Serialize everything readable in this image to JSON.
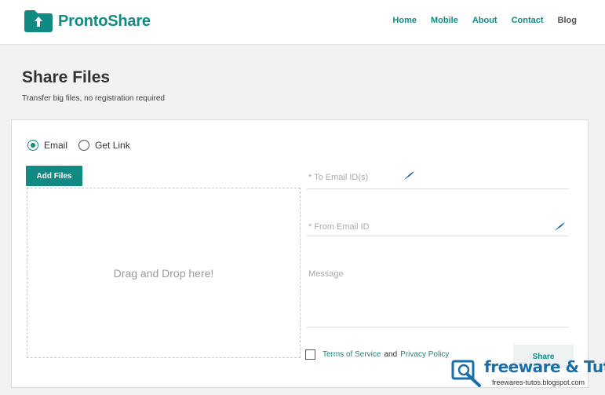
{
  "app": {
    "name": "ProntoShare"
  },
  "nav": {
    "items": [
      "Home",
      "Mobile",
      "About",
      "Contact",
      "Blog"
    ]
  },
  "page": {
    "title": "Share Files",
    "subtitle": "Transfer big files, no registration required"
  },
  "form": {
    "radio_email": "Email",
    "radio_link": "Get Link",
    "selected": "Email",
    "add_files_label": "Add Files",
    "dropzone_text": "Drag and Drop here!",
    "to_email_placeholder": "* To Email ID(s)",
    "from_email_placeholder": "* From Email ID",
    "message_placeholder": "Message",
    "terms_link": "Terms of Service",
    "and_text": "and",
    "privacy_link": "Privacy Policy",
    "share_label": "Share"
  },
  "watermark": {
    "title": "freeware & Tutos",
    "url": "freewares-tutos.blogspot.com"
  },
  "colors": {
    "brand": "#108a82",
    "watermark_blue": "#1a6fa8"
  },
  "icons": {
    "logo": "folder-upload-icon",
    "autofill": "feather-icon",
    "watermark": "magnifier-icon"
  }
}
